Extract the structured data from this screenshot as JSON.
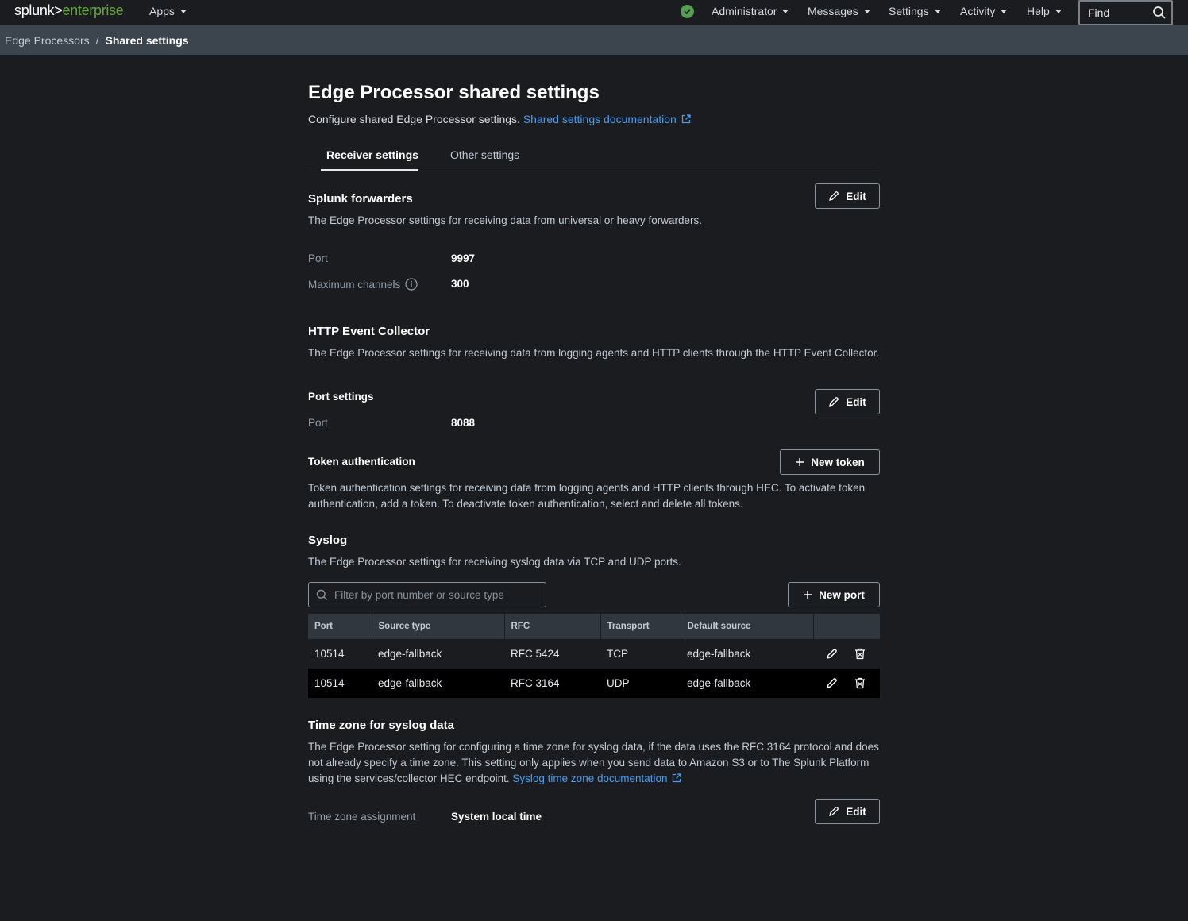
{
  "topnav": {
    "logo_part1": "splunk>",
    "logo_part2": "enterprise",
    "apps": "Apps",
    "administrator": "Administrator",
    "messages": "Messages",
    "settings": "Settings",
    "activity": "Activity",
    "help": "Help",
    "find_placeholder": "Find"
  },
  "breadcrumb": {
    "parent": "Edge Processors",
    "separator": "/",
    "current": "Shared settings"
  },
  "page": {
    "title": "Edge Processor shared settings",
    "subtitle": "Configure shared Edge Processor settings.",
    "subtitle_link": "Shared settings documentation"
  },
  "tabs": [
    {
      "label": "Receiver settings",
      "active": true
    },
    {
      "label": "Other settings",
      "active": false
    }
  ],
  "forwarders": {
    "title": "Splunk forwarders",
    "description": "The Edge Processor settings for receiving data from universal or heavy forwarders.",
    "edit_label": "Edit",
    "port_label": "Port",
    "port_value": "9997",
    "channels_label": "Maximum channels",
    "channels_value": "300"
  },
  "hec": {
    "title": "HTTP Event Collector",
    "description": "The Edge Processor settings for receiving data from logging agents and HTTP clients through the HTTP Event Collector.",
    "port_settings_title": "Port settings",
    "edit_label": "Edit",
    "port_label": "Port",
    "port_value": "8088",
    "token_title": "Token authentication",
    "new_token_label": "New token",
    "token_description": "Token authentication settings for receiving data from logging agents and HTTP clients through HEC. To activate token authentication, add a token. To deactivate token authentication, select and delete all tokens."
  },
  "syslog": {
    "title": "Syslog",
    "description": "The Edge Processor settings for receiving syslog data via TCP and UDP ports.",
    "filter_placeholder": "Filter by port number or source type",
    "new_port_label": "New port",
    "columns": [
      "Port",
      "Source type",
      "RFC",
      "Transport",
      "Default source"
    ],
    "rows": [
      {
        "port": "10514",
        "source_type": "edge-fallback",
        "rfc": "RFC 5424",
        "transport": "TCP",
        "default_source": "edge-fallback"
      },
      {
        "port": "10514",
        "source_type": "edge-fallback",
        "rfc": "RFC 3164",
        "transport": "UDP",
        "default_source": "edge-fallback"
      }
    ]
  },
  "timezone": {
    "title": "Time zone for syslog data",
    "description": "The Edge Processor setting for configuring a time zone for syslog data, if the data uses the RFC 3164 protocol and does not already specify a time zone. This setting only applies when you send data to Amazon S3 or to The Splunk Platform using the services/collector HEC endpoint.",
    "doc_link": "Syslog time zone documentation",
    "label": "Time zone assignment",
    "value": "System local time",
    "edit_label": "Edit"
  },
  "colors": {
    "accent_link": "#4a9df2",
    "status_ok": "#53a051",
    "brand_green": "#65a637"
  }
}
